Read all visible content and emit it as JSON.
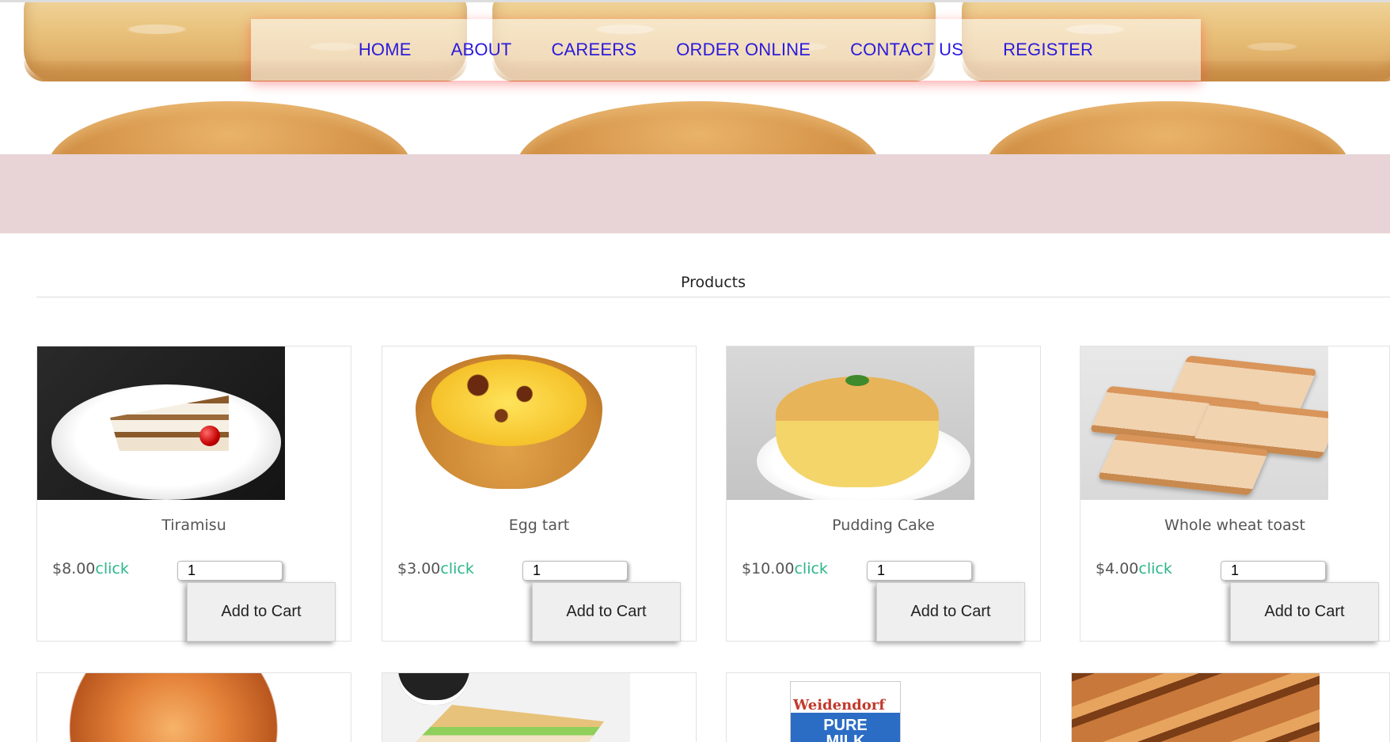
{
  "nav": {
    "links": [
      {
        "label": "HOME"
      },
      {
        "label": "ABOUT"
      },
      {
        "label": "CAREERS"
      },
      {
        "label": "ORDER ONLINE"
      },
      {
        "label": "CONTACT US"
      },
      {
        "label": "REGISTER"
      }
    ],
    "link_color": "#2a1adb"
  },
  "colors": {
    "band": "#e8d4d6",
    "click_accent": "#2bb58a",
    "nav_shadow": "#ff3c3c"
  },
  "products": {
    "title": "Products",
    "items": [
      {
        "name": "Tiramisu",
        "price": "$8.00",
        "click": "click",
        "qty": "1",
        "button": "Add to Cart"
      },
      {
        "name": "Egg tart",
        "price": "$3.00",
        "click": "click",
        "qty": "1",
        "button": "Add to Cart"
      },
      {
        "name": "Pudding Cake",
        "price": "$10.00",
        "click": "click",
        "qty": "1",
        "button": "Add to Cart"
      },
      {
        "name": "Whole wheat toast",
        "price": "$4.00",
        "click": "click",
        "qty": "1",
        "button": "Add to Cart"
      }
    ],
    "row2_labels": {
      "milk_brand": "Weidendorf",
      "milk_text": "PURE MILK"
    }
  }
}
